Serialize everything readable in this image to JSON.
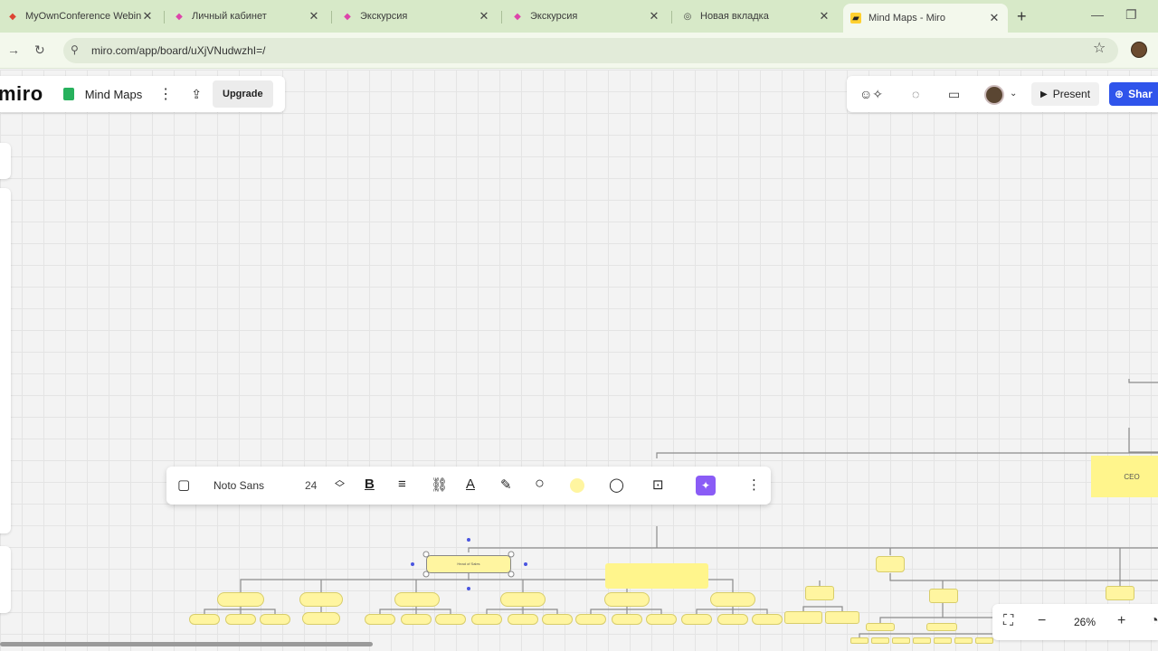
{
  "browser": {
    "tabs": [
      {
        "title": "MyOwnConference Webin",
        "active": false
      },
      {
        "title": "Личный кабинет",
        "active": false
      },
      {
        "title": "Экскурсия",
        "active": false
      },
      {
        "title": "Экскурсия",
        "active": false
      },
      {
        "title": "Новая вкладка",
        "active": false
      },
      {
        "title": "Mind Maps - Miro",
        "active": true
      }
    ],
    "new_tab": "+",
    "url": "miro.com/app/board/uXjVNudwzhI=/"
  },
  "app": {
    "logo": "miro",
    "board_name": "Mind Maps",
    "upgrade": "Upgrade",
    "present": "Present",
    "share": "Shar"
  },
  "toolbar": {
    "font": "Noto Sans",
    "size": "24",
    "bold": "B"
  },
  "canvas": {
    "ceo_label": "CEO",
    "selected_label": "Head of Sales"
  },
  "zoom": {
    "value": "26%"
  },
  "colors": {
    "sticky": "#fff5a0",
    "share_button": "#2f54eb",
    "ai_button": "#8a5cf6",
    "tabbar": "#d7e9c8"
  }
}
